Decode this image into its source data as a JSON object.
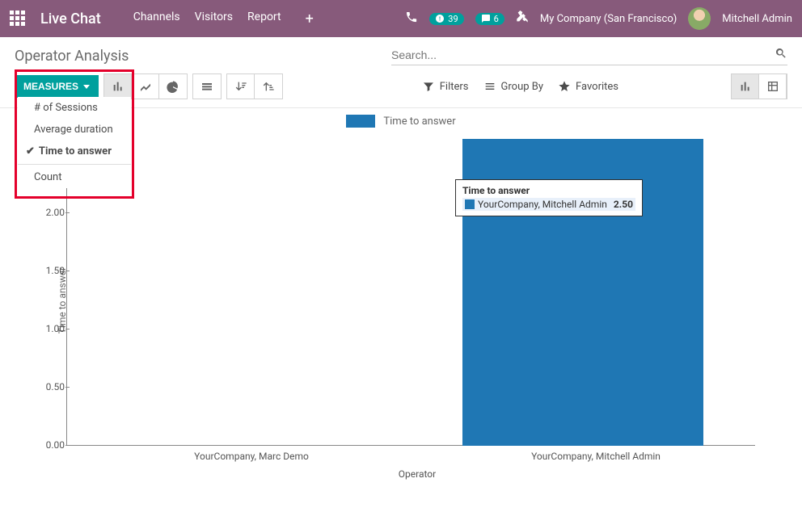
{
  "topbar": {
    "brand": "Live Chat",
    "menu": [
      "Channels",
      "Visitors",
      "Report"
    ],
    "timer_badge": "39",
    "chat_badge": "6",
    "company": "My Company (San Francisco)",
    "user": "Mitchell Admin"
  },
  "page": {
    "title": "Operator Analysis",
    "search_placeholder": "Search..."
  },
  "toolbar": {
    "measures_label": "MEASURES",
    "filters": "Filters",
    "groupby": "Group By",
    "favorites": "Favorites"
  },
  "measures_menu": {
    "items": [
      "# of Sessions",
      "Average duration",
      "Time to answer"
    ],
    "selected": "Time to answer",
    "count": "Count"
  },
  "chart_data": {
    "type": "bar",
    "title": "",
    "xlabel": "Operator",
    "ylabel": "Time to answer",
    "legend": "Time to answer",
    "categories": [
      "YourCompany, Marc Demo",
      "YourCompany, Mitchell Admin"
    ],
    "values": [
      0,
      2.5
    ],
    "ylim": [
      0,
      2.5
    ],
    "yticks": [
      "0.00",
      "0.50",
      "1.00",
      "1.50",
      "2.00"
    ]
  },
  "tooltip": {
    "title": "Time to answer",
    "series": "YourCompany, Mitchell Admin",
    "value": "2.50"
  }
}
